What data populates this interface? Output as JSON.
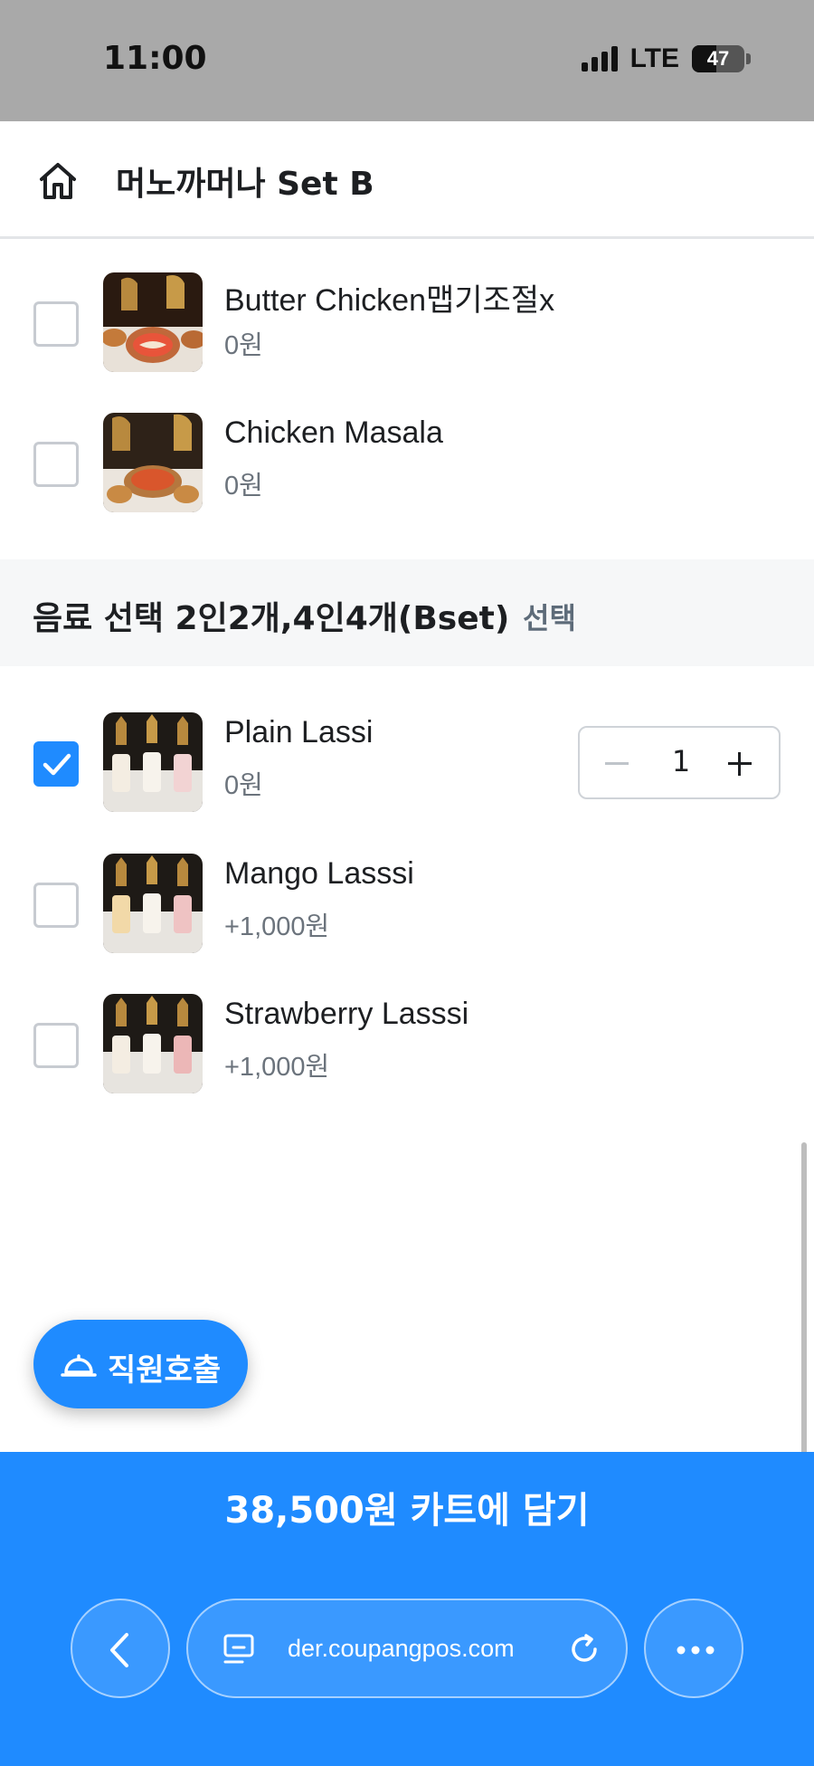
{
  "status_bar": {
    "time": "11:00",
    "network": "LTE",
    "battery": "47",
    "battery_level": 0.47
  },
  "header": {
    "title": "머노까머나 Set B",
    "home_icon": "home-icon"
  },
  "curry_options": [
    {
      "name": "Butter Chicken맵기조절x",
      "price": "0원",
      "checked": false
    },
    {
      "name": "Chicken Masala",
      "price": "0원",
      "checked": false
    }
  ],
  "drink_section": {
    "title": "음료 선택 2인2개,4인4개(Bset)",
    "badge": "선택"
  },
  "drink_options": [
    {
      "name": "Plain Lassi",
      "price": "0원",
      "checked": true,
      "quantity": "1"
    },
    {
      "name": "Mango Lasssi",
      "price": "+1,000원",
      "checked": false
    },
    {
      "name": "Strawberry Lasssi",
      "price": "+1,000원",
      "checked": false
    }
  ],
  "staff_call": {
    "label": "직원호출",
    "icon": "bell-icon"
  },
  "cart": {
    "label": "38,500원 카트에 담기"
  },
  "browser": {
    "url": "der.coupangpos.com",
    "back_icon": "chevron-left-icon",
    "reload_icon": "reload-icon",
    "more_icon": "more-icon"
  },
  "colors": {
    "accent": "#1f8bff",
    "status_bar": "#a9a9a9",
    "section_bg": "#f6f7f8"
  }
}
